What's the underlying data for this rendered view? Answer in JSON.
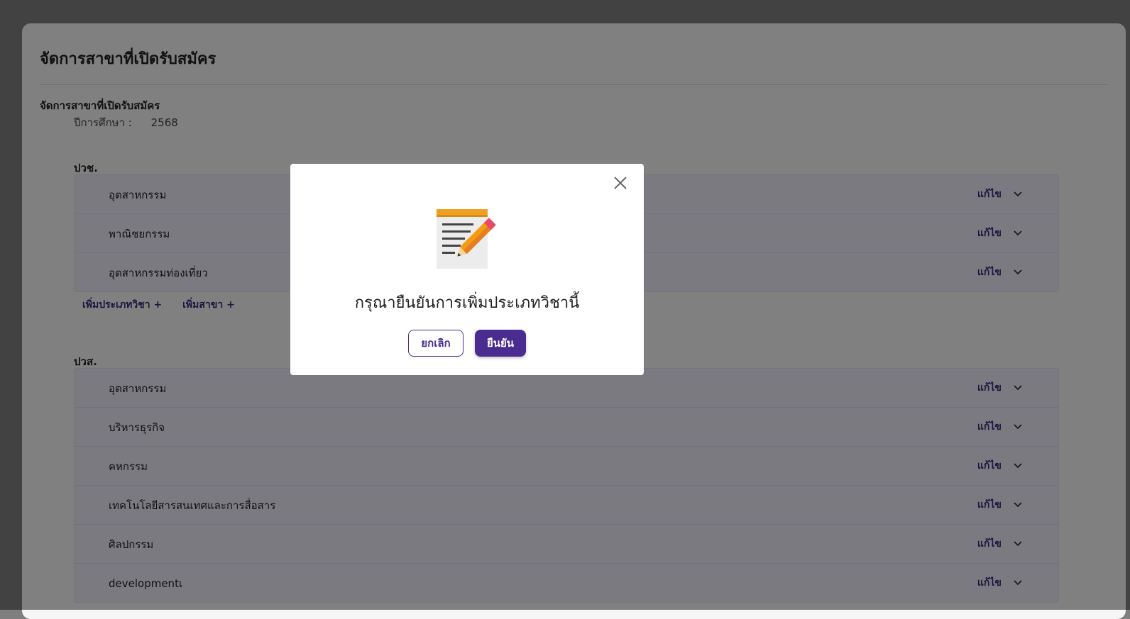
{
  "page": {
    "title": "จัดการสาขาที่เปิดรับสมัคร",
    "subtitle": "จัดการสาขาที่เปิดรับสมัคร",
    "year_label": "ปีการศึกษา :",
    "year_value": "2568"
  },
  "groups": [
    {
      "title": "ปวช.",
      "items": [
        {
          "label": "อุตสาหกรรม",
          "edit": "แก้ไข"
        },
        {
          "label": "พาณิชยกรรม",
          "edit": "แก้ไข"
        },
        {
          "label": "อุตสาหกรรมท่องเที่ยว",
          "edit": "แก้ไข"
        }
      ],
      "add_type": "เพิ่มประเภทวิชา +",
      "add_branch": "เพิ่มสาขา +"
    },
    {
      "title": "ปวส.",
      "items": [
        {
          "label": "อุตสาหกรรม",
          "edit": "แก้ไข"
        },
        {
          "label": "บริหารธุรกิจ",
          "edit": "แก้ไข"
        },
        {
          "label": "คหกรรม",
          "edit": "แก้ไข"
        },
        {
          "label": "เทคโนโลยีสารสนเทศและการสื่อสาร",
          "edit": "แก้ไข"
        },
        {
          "label": "ศิลปกรรม",
          "edit": "แก้ไข"
        },
        {
          "label": "developmentเ",
          "edit": "แก้ไข"
        }
      ]
    }
  ],
  "modal": {
    "message": "กรุณายืนยันการเพิ่มประเภทวิชานี้",
    "cancel_label": "ยกเลิก",
    "confirm_label": "ยืนยัน",
    "icon": "memo-pencil-icon"
  },
  "colors": {
    "accent": "#4a2b8f",
    "list_bg": "#eeeaf8",
    "overlay": "rgba(0,0,0,0.48)"
  }
}
